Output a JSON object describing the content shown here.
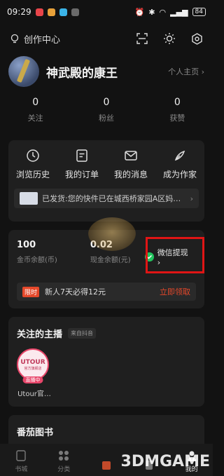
{
  "status_bar": {
    "time": "09:29",
    "battery": "84"
  },
  "header": {
    "creator_center": "创作中心"
  },
  "profile": {
    "username": "神武殿的康王",
    "homepage_link": "个人主页 ›"
  },
  "stats": [
    {
      "value": "0",
      "label": "关注"
    },
    {
      "value": "0",
      "label": "粉丝"
    },
    {
      "value": "0",
      "label": "获赞"
    }
  ],
  "functions": [
    {
      "label": "浏览历史",
      "icon": "clock-icon"
    },
    {
      "label": "我的订单",
      "icon": "order-icon"
    },
    {
      "label": "我的消息",
      "icon": "mail-icon"
    },
    {
      "label": "成为作家",
      "icon": "pen-icon"
    }
  ],
  "notice": {
    "text": "已发货:您的快件已在城西桥家园A区妈…"
  },
  "wallet": {
    "coins_value": "100",
    "coins_label": "金币余额(币)",
    "cash_value": "0.02",
    "cash_label": "现金余额(元)",
    "withdraw_label": "微信提现 ›"
  },
  "promo": {
    "tag": "限时",
    "text": "新人7天必得12元",
    "action": "立即领取"
  },
  "streamers_section": {
    "title": "关注的主播",
    "source_tag": "来自抖音",
    "streamers": [
      {
        "name": "Utour官…",
        "logo": "UTOUR",
        "logo_sub": "官方旗舰店",
        "live_label": "直播中"
      }
    ]
  },
  "books_section": {
    "title": "番茄图书"
  },
  "bottom_nav": [
    {
      "label": "书城",
      "icon": "book-icon"
    },
    {
      "label": "分类",
      "icon": "grid-icon"
    },
    {
      "label": "",
      "icon": "welfare-icon"
    },
    {
      "label": "",
      "icon": "listen-icon"
    },
    {
      "label": "我的",
      "icon": "user-icon"
    }
  ],
  "watermark": "3DMGAME",
  "colors": {
    "accent_red": "#e5482a",
    "highlight_box": "#e01515",
    "check_green": "#22c45e"
  }
}
